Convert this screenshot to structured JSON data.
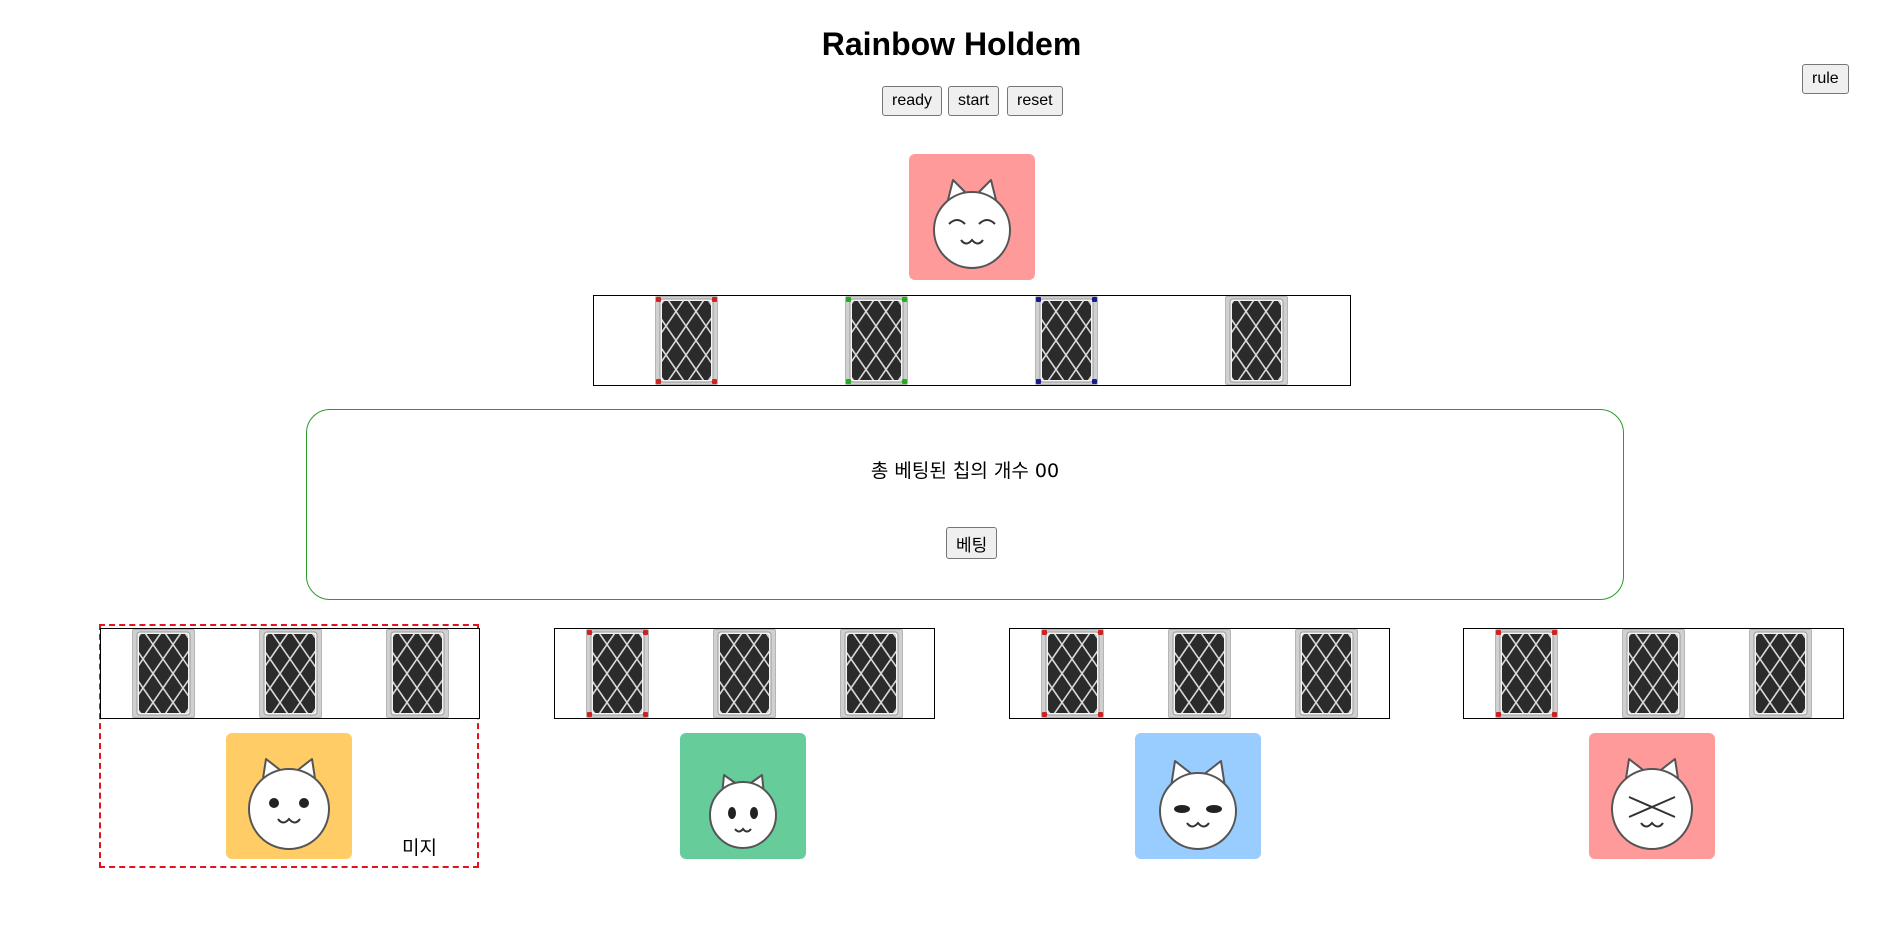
{
  "title": "Rainbow Holdem",
  "controls": {
    "ready": "ready",
    "start": "start",
    "reset": "reset",
    "rule": "rule"
  },
  "dealer": {
    "avatar_color": "#ff9a9a",
    "face": "smiling-cat-icon"
  },
  "community_cards": [
    {
      "corner_color": "#cc2222"
    },
    {
      "corner_color": "#22aa22"
    },
    {
      "corner_color": "#1a1a8c"
    },
    {
      "corner_color": ""
    }
  ],
  "pot": {
    "label": "총 베팅된 칩의 개수 00",
    "bet_button": "베팅"
  },
  "players": [
    {
      "name": "미지",
      "avatar_color": "#ffcc66",
      "face": "dot-eyes-cat-icon",
      "highlighted": true,
      "cards": [
        {
          "corner_color": ""
        },
        {
          "corner_color": ""
        },
        {
          "corner_color": ""
        }
      ]
    },
    {
      "name": "",
      "avatar_color": "#66cc99",
      "face": "oval-eyes-cat-icon",
      "highlighted": false,
      "cards": [
        {
          "corner_color": "#cc2222"
        },
        {
          "corner_color": ""
        },
        {
          "corner_color": ""
        }
      ]
    },
    {
      "name": "",
      "avatar_color": "#99ccff",
      "face": "sleepy-cat-icon",
      "highlighted": false,
      "cards": [
        {
          "corner_color": "#cc2222"
        },
        {
          "corner_color": ""
        },
        {
          "corner_color": ""
        }
      ]
    },
    {
      "name": "",
      "avatar_color": "#ff9a9a",
      "face": "x-eyes-cat-icon",
      "highlighted": false,
      "cards": [
        {
          "corner_color": "#cc2222"
        },
        {
          "corner_color": ""
        },
        {
          "corner_color": ""
        }
      ]
    }
  ]
}
